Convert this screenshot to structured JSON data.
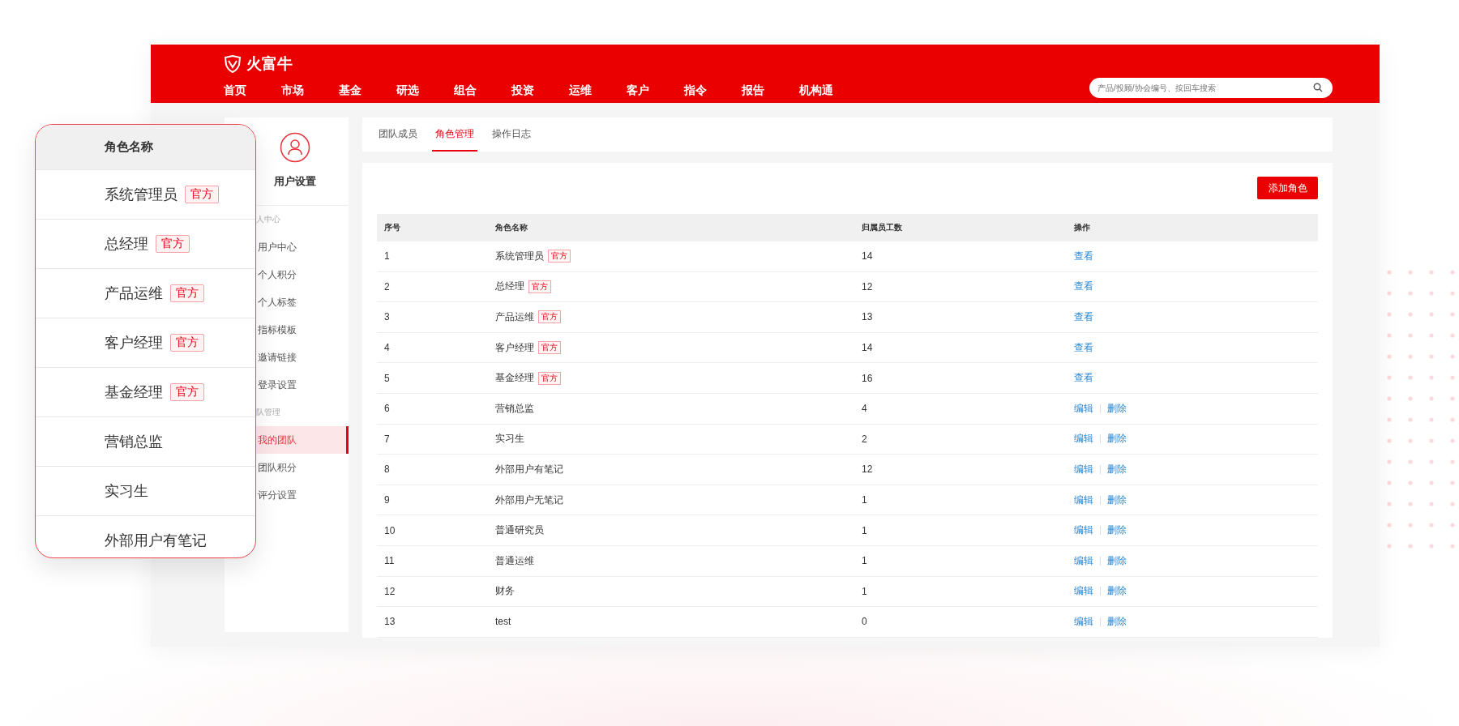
{
  "header": {
    "logo": "火富牛",
    "nav": [
      {
        "label": "首页",
        "selected": false
      },
      {
        "label": "市场",
        "selected": false
      },
      {
        "label": "基金",
        "selected": false
      },
      {
        "label": "研选",
        "selected": false
      },
      {
        "label": "组合",
        "selected": false
      },
      {
        "label": "投资",
        "selected": false
      },
      {
        "label": "运维",
        "selected": false
      },
      {
        "label": "客户",
        "selected": false
      },
      {
        "label": "指令",
        "selected": false
      },
      {
        "label": "报告",
        "selected": false
      },
      {
        "label": "机构通",
        "selected": false
      }
    ],
    "search": {
      "placeholder": "产品/投顾/协会编号、按回车搜索"
    }
  },
  "sidebar": {
    "title": "用户设置",
    "sections": [
      {
        "label": "人中心",
        "items": [
          {
            "label": "用户中心",
            "selected": false
          },
          {
            "label": "个人积分",
            "selected": false
          },
          {
            "label": "个人标签",
            "selected": false
          },
          {
            "label": "指标模板",
            "selected": false
          },
          {
            "label": "邀请链接",
            "selected": false
          },
          {
            "label": "登录设置",
            "selected": false
          }
        ]
      },
      {
        "label": "队管理",
        "items": [
          {
            "label": "我的团队",
            "selected": true
          },
          {
            "label": "团队积分",
            "selected": false
          },
          {
            "label": "评分设置",
            "selected": false
          }
        ]
      }
    ]
  },
  "tabs": [
    {
      "label": "团队成员",
      "selected": false
    },
    {
      "label": "角色管理",
      "selected": true
    },
    {
      "label": "操作日志",
      "selected": false
    }
  ],
  "add_button": "添加角色",
  "table": {
    "columns": [
      "序号",
      "角色名称",
      "归属员工数",
      "操作"
    ],
    "rows": [
      {
        "index": "1",
        "name": "系统管理员",
        "tag": "官方",
        "count": "14",
        "actions": [
          "查看"
        ]
      },
      {
        "index": "2",
        "name": "总经理",
        "tag": "官方",
        "count": "12",
        "actions": [
          "查看"
        ]
      },
      {
        "index": "3",
        "name": "产品运维",
        "tag": "官方",
        "count": "13",
        "actions": [
          "查看"
        ]
      },
      {
        "index": "4",
        "name": "客户经理",
        "tag": "官方",
        "count": "14",
        "actions": [
          "查看"
        ]
      },
      {
        "index": "5",
        "name": "基金经理",
        "tag": "官方",
        "count": "16",
        "actions": [
          "查看"
        ]
      },
      {
        "index": "6",
        "name": "营销总监",
        "count": "4",
        "actions": [
          "编辑",
          "删除"
        ]
      },
      {
        "index": "7",
        "name": "实习生",
        "count": "2",
        "actions": [
          "编辑",
          "删除"
        ]
      },
      {
        "index": "8",
        "name": "外部用户有笔记",
        "count": "12",
        "actions": [
          "编辑",
          "删除"
        ]
      },
      {
        "index": "9",
        "name": "外部用户无笔记",
        "count": "1",
        "actions": [
          "编辑",
          "删除"
        ]
      },
      {
        "index": "10",
        "name": "普通研究员",
        "count": "1",
        "actions": [
          "编辑",
          "删除"
        ]
      },
      {
        "index": "11",
        "name": "普通运维",
        "count": "1",
        "actions": [
          "编辑",
          "删除"
        ]
      },
      {
        "index": "12",
        "name": "财务",
        "count": "1",
        "actions": [
          "编辑",
          "删除"
        ]
      },
      {
        "index": "13",
        "name": "test",
        "count": "0",
        "actions": [
          "编辑",
          "删除"
        ]
      }
    ]
  },
  "callout": {
    "header": "角色名称",
    "rows": [
      {
        "name": "系统管理员",
        "tag": "官方"
      },
      {
        "name": "总经理",
        "tag": "官方"
      },
      {
        "name": "产品运维",
        "tag": "官方"
      },
      {
        "name": "客户经理",
        "tag": "官方"
      },
      {
        "name": "基金经理",
        "tag": "官方"
      },
      {
        "name": "营销总监"
      },
      {
        "name": "实习生"
      },
      {
        "name": "外部用户有笔记"
      }
    ]
  }
}
